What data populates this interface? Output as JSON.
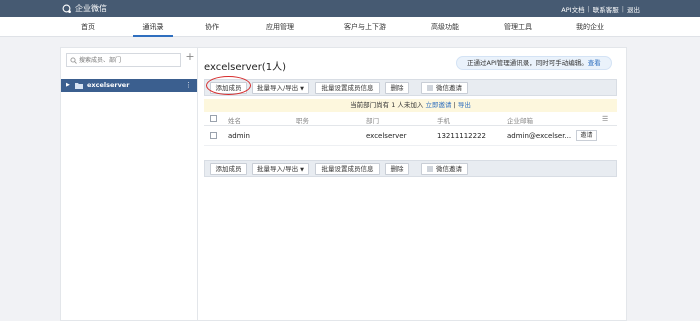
{
  "app": {
    "name": "企业微信"
  },
  "top_links": [
    "API文档",
    "联系客服",
    "退出"
  ],
  "nav": {
    "items": [
      {
        "label": "首页"
      },
      {
        "label": "通讯录"
      },
      {
        "label": "协作"
      },
      {
        "label": "应用管理"
      },
      {
        "label": "客户与上下游"
      },
      {
        "label": "高级功能"
      },
      {
        "label": "管理工具"
      },
      {
        "label": "我的企业"
      }
    ],
    "active": "通讯录"
  },
  "sidebar": {
    "search_placeholder": "搜索成员、部门",
    "department": "excelserver"
  },
  "main": {
    "title": "excelserver(1人)",
    "notice_text": "正通过API管理通讯录，同时可手动编辑。",
    "notice_link": "查看",
    "toolbar": {
      "add_member": "添加成员",
      "batch_import_export": "批量导入/导出",
      "batch_set_info": "批量设置成员信息",
      "delete": "删除",
      "wechat_invite": "微信邀请"
    },
    "info_bar": {
      "text": "当前部门尚有 1 人未加入",
      "invite_link": "立即邀请",
      "separator": "|",
      "export_link": "导出"
    },
    "table": {
      "headers": [
        "姓名",
        "职务",
        "部门",
        "手机",
        "企业邮箱"
      ],
      "rows": [
        {
          "name": "admin",
          "title": "",
          "dept": "excelserver",
          "phone": "13211112222",
          "email": "admin@excelser...",
          "action": "邀请"
        }
      ]
    }
  },
  "colors": {
    "topbar": "#465a72",
    "accent": "#2f6fbf",
    "sidebar_selected": "#3b5f8f",
    "highlight": "#d62b2b"
  }
}
